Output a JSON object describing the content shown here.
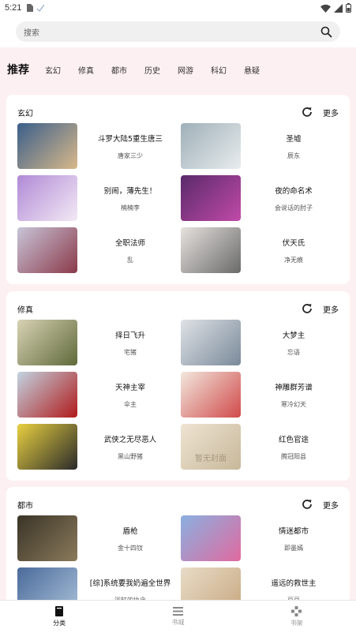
{
  "status_bar": {
    "time": "5:21"
  },
  "search": {
    "placeholder": "搜索"
  },
  "tabs": {
    "recommend": "推荐",
    "items": [
      "玄幻",
      "修真",
      "都市",
      "历史",
      "网游",
      "科幻",
      "悬疑"
    ]
  },
  "sections": [
    {
      "category": "玄幻",
      "more": "更多",
      "books": [
        {
          "title": "斗罗大陆5重生唐三",
          "author": "唐家三少",
          "cover_color": "#3a5f8a",
          "cover_color2": "#d9b88a"
        },
        {
          "title": "圣墟",
          "author": "辰东",
          "cover_color": "#9fb0b8",
          "cover_color2": "#e8ecee"
        },
        {
          "title": "别闹，薄先生！",
          "author": "楠楠李",
          "cover_color": "#b08ad6",
          "cover_color2": "#f3e9f5"
        },
        {
          "title": "夜的命名术",
          "author": "会说话的肘子",
          "cover_color": "#5a2a6a",
          "cover_color2": "#c04aa8"
        },
        {
          "title": "全职法师",
          "author": "乱",
          "cover_color": "#c8c4d8",
          "cover_color2": "#8a3a4a"
        },
        {
          "title": "伏天氏",
          "author": "净无痕",
          "cover_color": "#e6e2de",
          "cover_color2": "#6a6a6a"
        }
      ]
    },
    {
      "category": "修真",
      "more": "更多",
      "books": [
        {
          "title": "择日飞升",
          "author": "宅猪",
          "cover_color": "#d8d2b4",
          "cover_color2": "#5f6a3a"
        },
        {
          "title": "大梦主",
          "author": "忘语",
          "cover_color": "#dfe2e6",
          "cover_color2": "#7a8a9a"
        },
        {
          "title": "天神主宰",
          "author": "伞主",
          "cover_color": "#c2d4e2",
          "cover_color2": "#b01a1a"
        },
        {
          "title": "神雕群芳谱",
          "author": "寒冷幻天",
          "cover_color": "#f2e8de",
          "cover_color2": "#d04a4a"
        },
        {
          "title": "武侠之无尽恶人",
          "author": "黑山野猪",
          "cover_color": "#e8d040",
          "cover_color2": "#2a2a2a"
        },
        {
          "title": "红色官途",
          "author": "腾冠阳县",
          "cover_color": "#eee4d2",
          "cover_color2": "#c8b89a",
          "cover_text": "暂无封面"
        }
      ]
    },
    {
      "category": "都市",
      "more": "更多",
      "books": [
        {
          "title": "盾枪",
          "author": "金十四钗",
          "cover_color": "#3a3428",
          "cover_color2": "#8a7a5a"
        },
        {
          "title": "情迷都市",
          "author": "即墨嫣",
          "cover_color": "#8ab0e0",
          "cover_color2": "#e06aa0"
        },
        {
          "title": "[综]系统要我奶遍全世界",
          "author": "浴缸的执念",
          "cover_color": "#4a6a9a",
          "cover_color2": "#a8c0d8"
        },
        {
          "title": "遥远的救世主",
          "author": "豆豆",
          "cover_color": "#e8dcc8",
          "cover_color2": "#c8a880"
        }
      ]
    }
  ],
  "bottom_nav": [
    {
      "label": "分类",
      "icon": "book-icon"
    },
    {
      "label": "书城",
      "icon": "list-icon"
    },
    {
      "label": "书架",
      "icon": "grid-icon"
    }
  ]
}
